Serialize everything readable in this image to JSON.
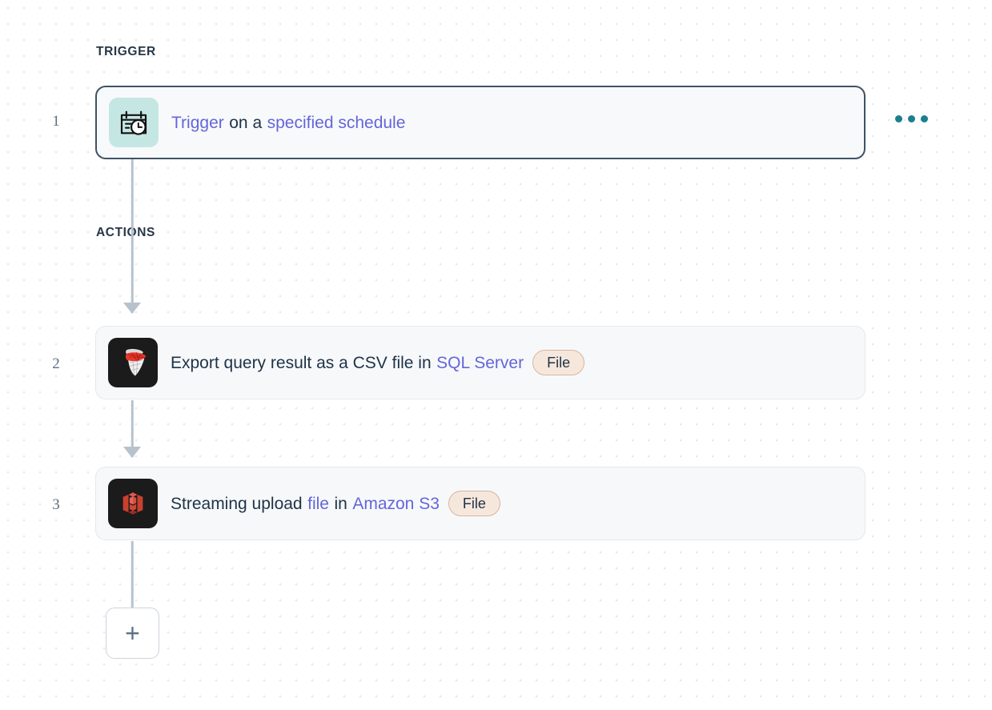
{
  "canvas": {
    "grid_dot_color": "#e8e8ea",
    "background": "#ffffff"
  },
  "sections": {
    "trigger_label": "TRIGGER",
    "actions_label": "ACTIONS"
  },
  "colors": {
    "link": "#6366d9",
    "text": "#1d3347",
    "badge_bg": "#f6e7dc",
    "badge_border": "#d6b7a2",
    "connector": "#b6c2cd",
    "selected_border": "#3f5366",
    "menu_dot": "#1a7f8e",
    "schedule_tile": "#c5e7e3"
  },
  "steps": [
    {
      "number": "1",
      "icon": "calendar-clock-icon",
      "selected": true,
      "parts": [
        {
          "text": "Trigger",
          "link": true
        },
        {
          "text": "on a",
          "link": false
        },
        {
          "text": "specified schedule",
          "link": true
        }
      ],
      "badge": null
    },
    {
      "number": "2",
      "icon": "sql-server-icon",
      "selected": false,
      "parts": [
        {
          "text": "Export query result as a CSV file in",
          "link": false
        },
        {
          "text": "SQL Server",
          "link": true
        }
      ],
      "badge": "File"
    },
    {
      "number": "3",
      "icon": "amazon-s3-icon",
      "selected": false,
      "parts": [
        {
          "text": "Streaming upload",
          "link": false
        },
        {
          "text": "file",
          "link": true
        },
        {
          "text": "in",
          "link": false
        },
        {
          "text": "Amazon S3",
          "link": true
        }
      ],
      "badge": "File"
    }
  ],
  "more_menu": {
    "label": "more-options"
  },
  "add_button": {
    "label": "+"
  }
}
